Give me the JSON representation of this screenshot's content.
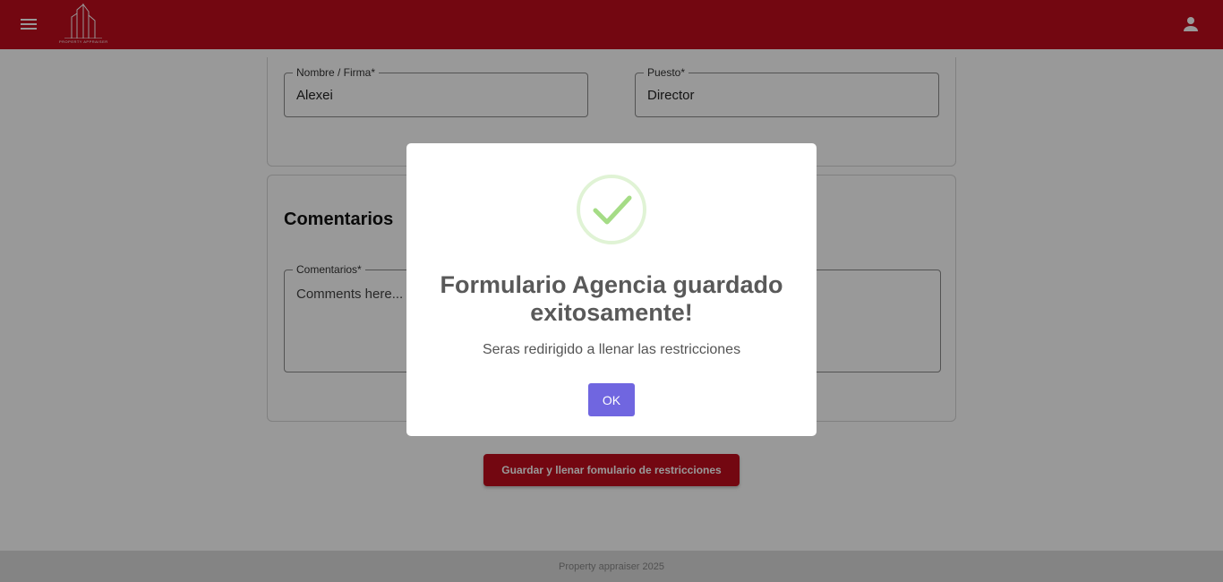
{
  "header": {
    "logo_text": "PROPERTY APPRAISER"
  },
  "form": {
    "nombre_label": "Nombre / Firma*",
    "nombre_value": "Alexei",
    "puesto_label": "Puesto*",
    "puesto_value": "Director",
    "comentarios_title": "Comentarios",
    "comentarios_label": "Comentarios*",
    "comentarios_value": "Comments here...",
    "save_button": "Guardar y llenar fomulario de restricciones"
  },
  "footer": {
    "text": "Property appraiser 2025"
  },
  "dialog": {
    "title": "Formulario Agencia guardado exitosamente!",
    "message": "Seras redirigido a llenar las restricciones",
    "ok_label": "OK"
  },
  "colors": {
    "brand": "#c00c1d",
    "confirm": "#7066e0",
    "success": "#a5dc86"
  },
  "icons": [
    "menu-icon",
    "building-logo-icon",
    "person-icon",
    "success-check-icon"
  ]
}
